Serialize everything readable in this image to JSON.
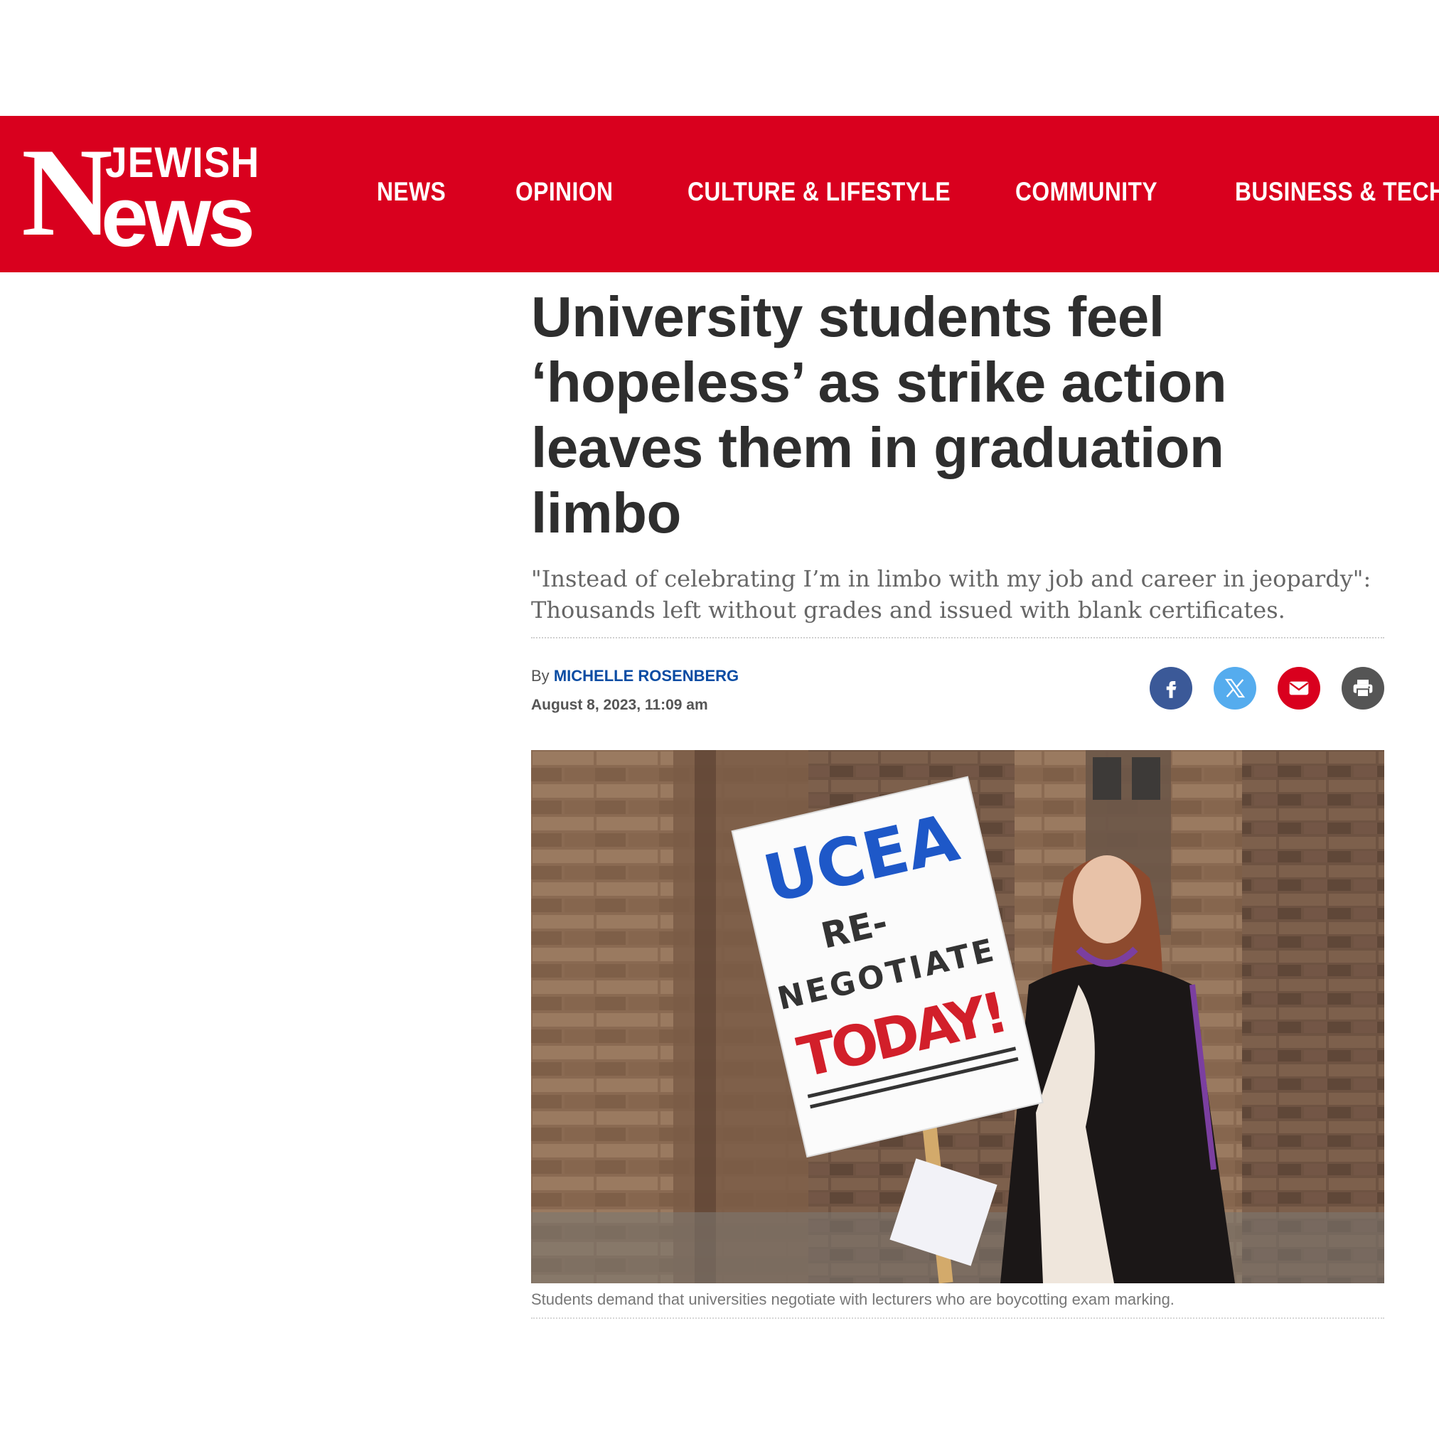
{
  "site": {
    "logo_letter": "N",
    "logo_top": "JEWISH",
    "logo_bottom": "ews",
    "brand_color": "#d9001e"
  },
  "nav": {
    "items": [
      "NEWS",
      "OPINION",
      "CULTURE & LIFESTYLE",
      "COMMUNITY",
      "BUSINESS & TECH"
    ]
  },
  "article": {
    "headline": "University students feel ‘hopeless’ as strike action leaves them in graduation limbo",
    "standfirst": "\"Instead of celebrating I’m in limbo with my job and career in jeopardy\": Thousands left without grades and issued with blank certificates.",
    "by_label": "By",
    "author": "MICHELLE ROSENBERG",
    "date": "August 8, 2023, 11:09 am",
    "caption": "Students demand that universities negotiate with lecturers who are boycotting exam marking."
  },
  "share": {
    "buttons": [
      {
        "name": "facebook",
        "icon": "facebook-icon",
        "color": "#3b5998"
      },
      {
        "name": "x",
        "icon": "x-icon",
        "color": "#55acee"
      },
      {
        "name": "email",
        "icon": "email-icon",
        "color": "#d9001e"
      },
      {
        "name": "print",
        "icon": "print-icon",
        "color": "#555555"
      }
    ]
  },
  "photo": {
    "sign_line1": "UCEA",
    "sign_line2": "RE-",
    "sign_line3": "NEGOTIATE",
    "sign_line4": "TODAY!"
  }
}
